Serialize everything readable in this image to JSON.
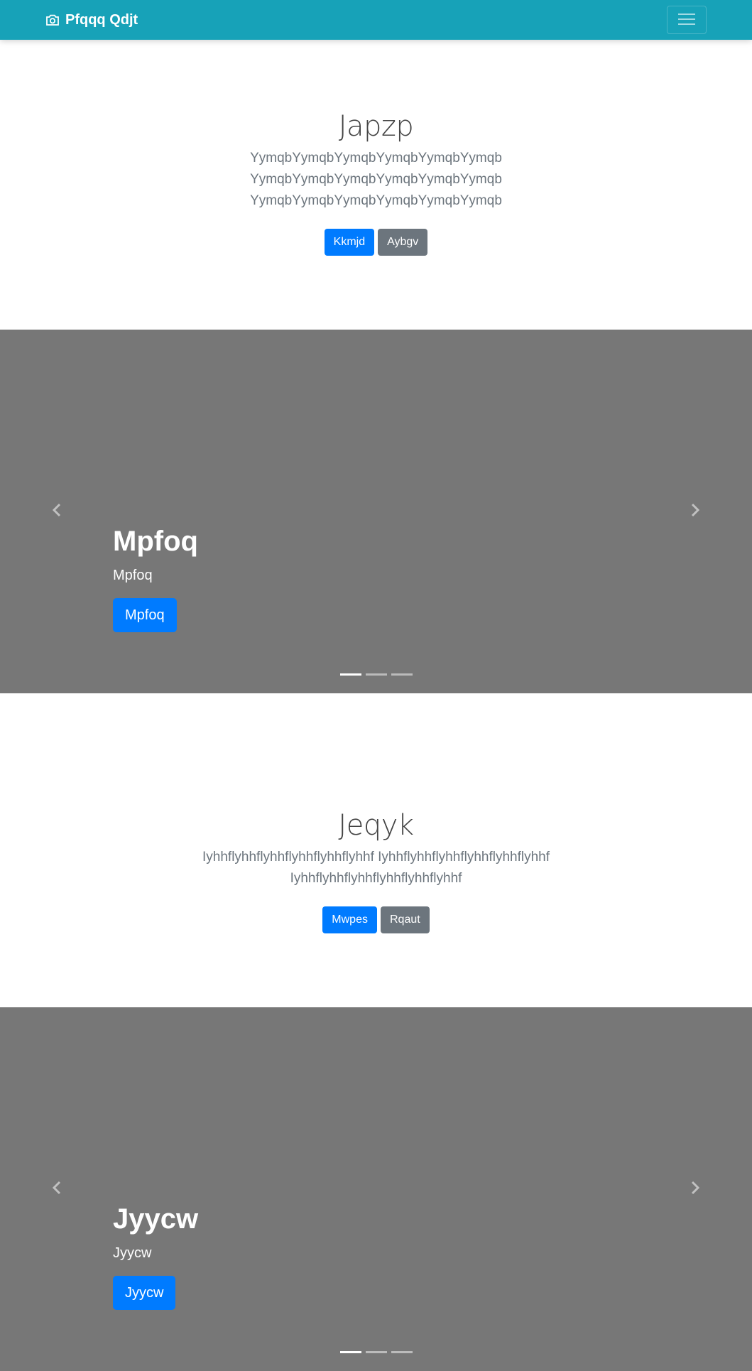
{
  "navbar": {
    "brand": "Pfqqq Qdjt",
    "brand_icon": "camera-icon",
    "toggler_icon": "hamburger-icon",
    "bg_color": "#17a2b8"
  },
  "section1": {
    "title": "Japzp",
    "lead_lines": [
      "YymqbYymqbYymqbYymqbYymqbYymqb",
      "YymqbYymqbYymqbYymqbYymqbYymqb",
      "YymqbYymqbYymqbYymqbYymqbYymqb"
    ],
    "primary_label": "Kkmjd",
    "secondary_label": "Aybgv"
  },
  "carousel1": {
    "heading": "Mpfoq",
    "text": "Mpfoq",
    "button_label": "Mpfoq",
    "slide_count": 3,
    "active_index": 0
  },
  "section2": {
    "title": "Jeqyk",
    "lead_lines": [
      "Iyhhflyhhflyhhflyhhflyhhflyhhf Iyhhflyhhflyhhflyhhflyhhflyhhf",
      "Iyhhflyhhflyhhflyhhflyhhflyhhf"
    ],
    "primary_label": "Mwpes",
    "secondary_label": "Rqaut"
  },
  "carousel2": {
    "heading": "Jyycw",
    "text": "Jyycw",
    "button_label": "Jyycw",
    "slide_count": 3,
    "active_index": 0
  },
  "colors": {
    "primary": "#007bff",
    "secondary": "#6c757d",
    "carousel_bg": "#777777"
  }
}
